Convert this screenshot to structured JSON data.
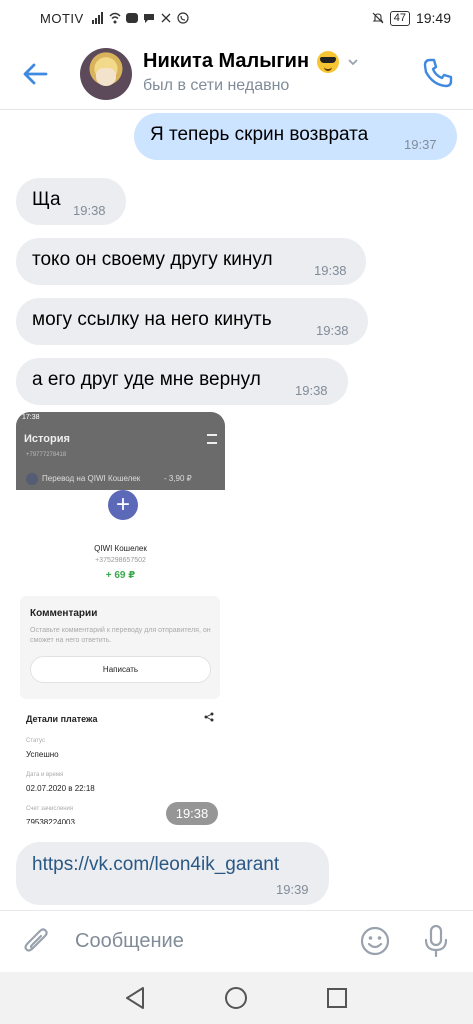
{
  "status_bar": {
    "carrier": "MOTIV",
    "battery": "47",
    "time": "19:49"
  },
  "header": {
    "name": "Никита Малыгин",
    "status": "был в сети недавно"
  },
  "messages": [
    {
      "direction": "out",
      "text": "Я теперь скрин возврата",
      "time": "19:37"
    },
    {
      "direction": "in",
      "text": "Ща",
      "time": "19:38"
    },
    {
      "direction": "in",
      "text": "токо он своему другу кинул",
      "time": "19:38"
    },
    {
      "direction": "in",
      "text": "могу ссылку на него кинуть",
      "time": "19:38"
    },
    {
      "direction": "in",
      "text": "а его друг уде мне вернул",
      "time": "19:38"
    },
    {
      "direction": "in",
      "type": "image",
      "time": "19:38"
    },
    {
      "direction": "in",
      "type": "link",
      "text": "https://vk.com/leon4ik_garant",
      "time": "19:39"
    }
  ],
  "screenshot": {
    "status_time": "17:38",
    "history_title": "История",
    "row_top": "+79777278418",
    "row_transfer": "Перевод на QIWI Кошелек",
    "row_amount": "- 3,90 ₽",
    "wallet_name": "QIWI Кошелек",
    "wallet_phone": "+375298657502",
    "amount": "+ 69 ₽",
    "comments_title": "Комментарии",
    "comments_desc": "Оставьте комментарий к переводу для отправителя, он сможет на него ответить.",
    "write_button": "Написать",
    "details_title": "Детали платежа",
    "status_label": "Статус",
    "status_value": "Успешно",
    "date_label": "Дата и время",
    "date_value": "02.07.2020 в 22:18",
    "account_label": "Счет зачисления",
    "account_value": "79538224003"
  },
  "composer": {
    "placeholder": "Сообщение"
  }
}
